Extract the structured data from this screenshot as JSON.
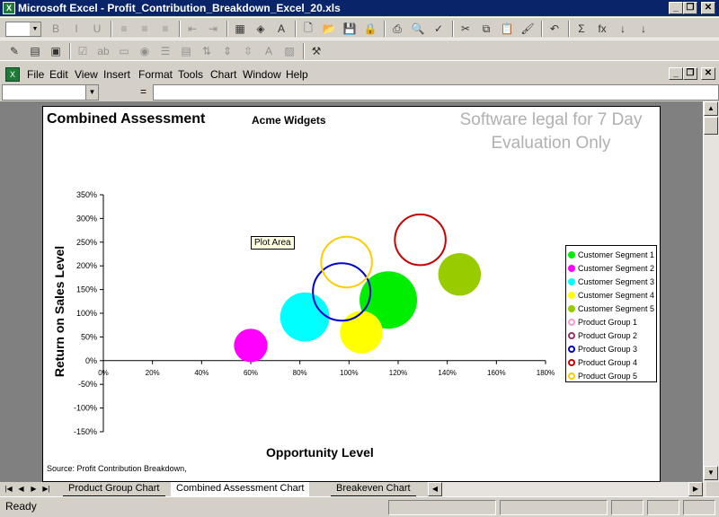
{
  "window": {
    "title": "Microsoft Excel - Profit_Contribution_Breakdown_Excel_20.xls",
    "app_icon": "excel-icon",
    "controls": [
      "minimize",
      "restore",
      "close"
    ]
  },
  "toolbar_format": {
    "font_size": "",
    "buttons": [
      {
        "name": "bold-icon",
        "glyph": "B"
      },
      {
        "name": "italic-icon",
        "glyph": "I"
      },
      {
        "name": "underline-icon",
        "glyph": "U"
      },
      {
        "name": "align-left-icon",
        "glyph": "≡"
      },
      {
        "name": "align-center-icon",
        "glyph": "≡"
      },
      {
        "name": "align-right-icon",
        "glyph": "≡"
      },
      {
        "name": "decrease-indent-icon",
        "glyph": "⇤"
      },
      {
        "name": "increase-indent-icon",
        "glyph": "⇥"
      },
      {
        "name": "borders-icon",
        "glyph": "▦"
      },
      {
        "name": "fill-color-icon",
        "glyph": "◈"
      },
      {
        "name": "font-color-icon",
        "glyph": "A"
      },
      {
        "name": "new-icon",
        "glyph": "🗋"
      },
      {
        "name": "open-icon",
        "glyph": "📂"
      },
      {
        "name": "save-icon",
        "glyph": "💾"
      },
      {
        "name": "permission-icon",
        "glyph": "🔒"
      },
      {
        "name": "print-icon",
        "glyph": "⎙"
      },
      {
        "name": "print-preview-icon",
        "glyph": "🔍"
      },
      {
        "name": "spelling-icon",
        "glyph": "✓"
      },
      {
        "name": "cut-icon",
        "glyph": "✂"
      },
      {
        "name": "copy-icon",
        "glyph": "⧉"
      },
      {
        "name": "paste-icon",
        "glyph": "📋"
      },
      {
        "name": "format-painter-icon",
        "glyph": "🖌"
      },
      {
        "name": "undo-icon",
        "glyph": "↶"
      },
      {
        "name": "autosum-icon",
        "glyph": "Σ"
      },
      {
        "name": "function-icon",
        "glyph": "fx"
      },
      {
        "name": "sort-ascending-icon",
        "glyph": "↓"
      },
      {
        "name": "sort-descending-icon",
        "glyph": "↓"
      }
    ]
  },
  "toolbar_forms": {
    "buttons": [
      {
        "name": "design-mode-icon",
        "glyph": "✎"
      },
      {
        "name": "properties-icon",
        "glyph": "▤"
      },
      {
        "name": "view-code-icon",
        "glyph": "▣"
      },
      {
        "name": "checkbox-icon",
        "glyph": "☑"
      },
      {
        "name": "textbox-icon",
        "glyph": "ab"
      },
      {
        "name": "command-button-icon",
        "glyph": "▭"
      },
      {
        "name": "option-button-icon",
        "glyph": "◉"
      },
      {
        "name": "listbox-icon",
        "glyph": "☰"
      },
      {
        "name": "combobox-icon",
        "glyph": "▤"
      },
      {
        "name": "toggle-button-icon",
        "glyph": "⇅"
      },
      {
        "name": "spin-button-icon",
        "glyph": "⇕"
      },
      {
        "name": "scrollbar-icon",
        "glyph": "⇳"
      },
      {
        "name": "label-icon",
        "glyph": "A"
      },
      {
        "name": "image-icon",
        "glyph": "▨"
      },
      {
        "name": "more-controls-icon",
        "glyph": "⚒"
      }
    ]
  },
  "menubar": {
    "items": [
      "File",
      "Edit",
      "View",
      "Insert",
      "Format",
      "Tools",
      "Chart",
      "Window",
      "Help"
    ]
  },
  "formula_bar": {
    "name_box": "",
    "equals": "=",
    "value": ""
  },
  "chart": {
    "title": "Combined Assessment",
    "subtitle": "Acme Widgets",
    "watermark_line1": "Software legal for 7 Day",
    "watermark_line2": "Evaluation Only",
    "tooltip": "Plot Area",
    "source_note": "Source: Profit Contribution Breakdown,"
  },
  "chart_data": {
    "type": "scatter",
    "title": "Combined Assessment",
    "subtitle": "Acme Widgets",
    "xlabel": "Opportunity Level",
    "ylabel": "Return on Sales Level",
    "xlim": [
      0,
      1.8
    ],
    "ylim": [
      -1.5,
      3.5
    ],
    "x_ticks": [
      "0%",
      "20%",
      "40%",
      "60%",
      "80%",
      "100%",
      "120%",
      "140%",
      "160%",
      "180%"
    ],
    "y_ticks": [
      "350%",
      "300%",
      "250%",
      "200%",
      "150%",
      "100%",
      "50%",
      "0%",
      "-50%",
      "-100%",
      "-150%"
    ],
    "legend_position": "right",
    "series": [
      {
        "name": "Customer Segment 1",
        "x": 1.16,
        "y": 1.28,
        "size": 1.0,
        "color": "#00ee00",
        "filled": true
      },
      {
        "name": "Customer Segment 2",
        "x": 0.6,
        "y": 0.32,
        "size": 0.34,
        "color": "#ff00ff",
        "filled": true
      },
      {
        "name": "Customer Segment 3",
        "x": 0.82,
        "y": 0.92,
        "size": 0.73,
        "color": "#00ffff",
        "filled": true
      },
      {
        "name": "Customer Segment 4",
        "x": 1.05,
        "y": 0.6,
        "size": 0.55,
        "color": "#ffff00",
        "filled": true
      },
      {
        "name": "Customer Segment 5",
        "x": 1.45,
        "y": 1.82,
        "size": 0.55,
        "color": "#99cc00",
        "filled": true
      },
      {
        "name": "Product Group 1",
        "x": null,
        "y": null,
        "size": 0,
        "color": "#ff99cc",
        "filled": false
      },
      {
        "name": "Product Group 2",
        "x": null,
        "y": null,
        "size": 0,
        "color": "#993366",
        "filled": false
      },
      {
        "name": "Product Group 3",
        "x": 0.97,
        "y": 1.45,
        "size": 1.0,
        "color": "#0000cc",
        "filled": false
      },
      {
        "name": "Product Group 4",
        "x": 1.29,
        "y": 2.55,
        "size": 0.78,
        "color": "#cc0000",
        "filled": false
      },
      {
        "name": "Product Group 5",
        "x": 0.99,
        "y": 2.08,
        "size": 0.78,
        "color": "#ffcc00",
        "filled": false
      }
    ]
  },
  "sheet_tabs": {
    "tabs": [
      "Product Group Chart",
      "Combined Assessment Chart",
      "Breakeven Chart"
    ],
    "active": "Combined Assessment Chart"
  },
  "status_bar": {
    "text": "Ready"
  }
}
